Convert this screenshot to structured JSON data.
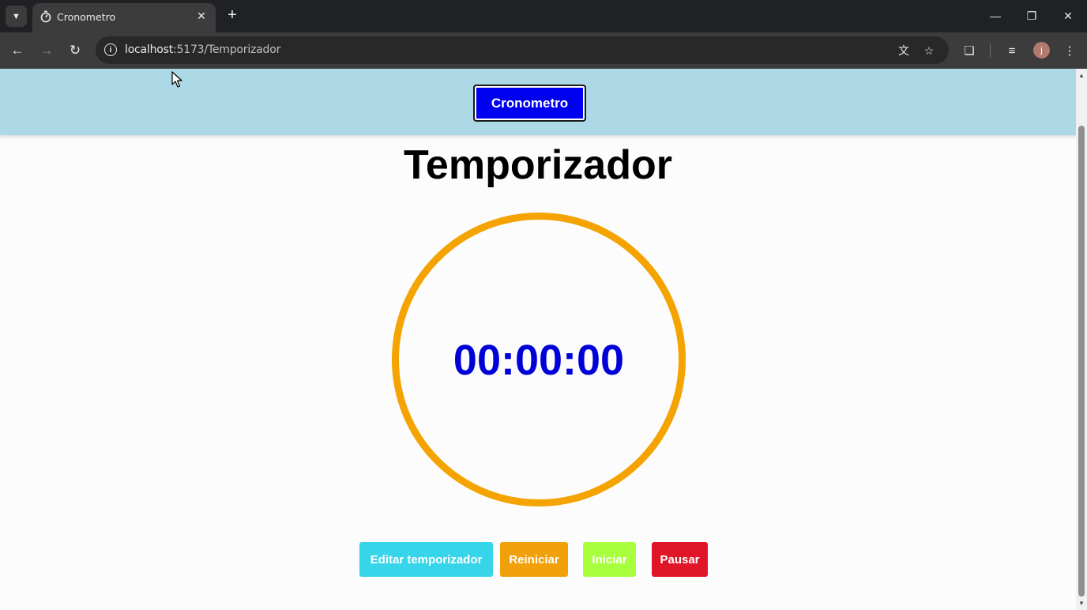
{
  "browser": {
    "tab_title": "Cronometro",
    "url_host": "localhost",
    "url_path": ":5173/Temporizador",
    "icons": {
      "tab_search": "chevron-down-icon",
      "favicon": "stopwatch-icon",
      "close": "close-icon",
      "new_tab": "plus-icon",
      "back": "back-arrow-icon",
      "forward": "forward-arrow-icon",
      "reload": "reload-icon",
      "info": "info-icon",
      "translate": "translate-icon",
      "bookmark": "star-icon",
      "extensions": "puzzle-icon",
      "media": "media-queue-icon",
      "menu": "kebab-menu-icon"
    },
    "avatar_letter": "j"
  },
  "header": {
    "nav_button_label": "Cronometro"
  },
  "main": {
    "title": "Temporizador",
    "time_display": "00:00:00",
    "buttons": {
      "edit": "Editar temporizador",
      "reset": "Reiniciar",
      "start": "Iniciar",
      "pause": "Pausar"
    }
  },
  "colors": {
    "header_bg": "#add8e6",
    "nav_button_bg": "#0000f0",
    "ring": "#f4a300",
    "time_text": "#0000d8",
    "edit_btn": "#37d5ea",
    "reset_btn": "#f0a10a",
    "start_btn": "#a8ff3e",
    "pause_btn": "#e01628"
  }
}
